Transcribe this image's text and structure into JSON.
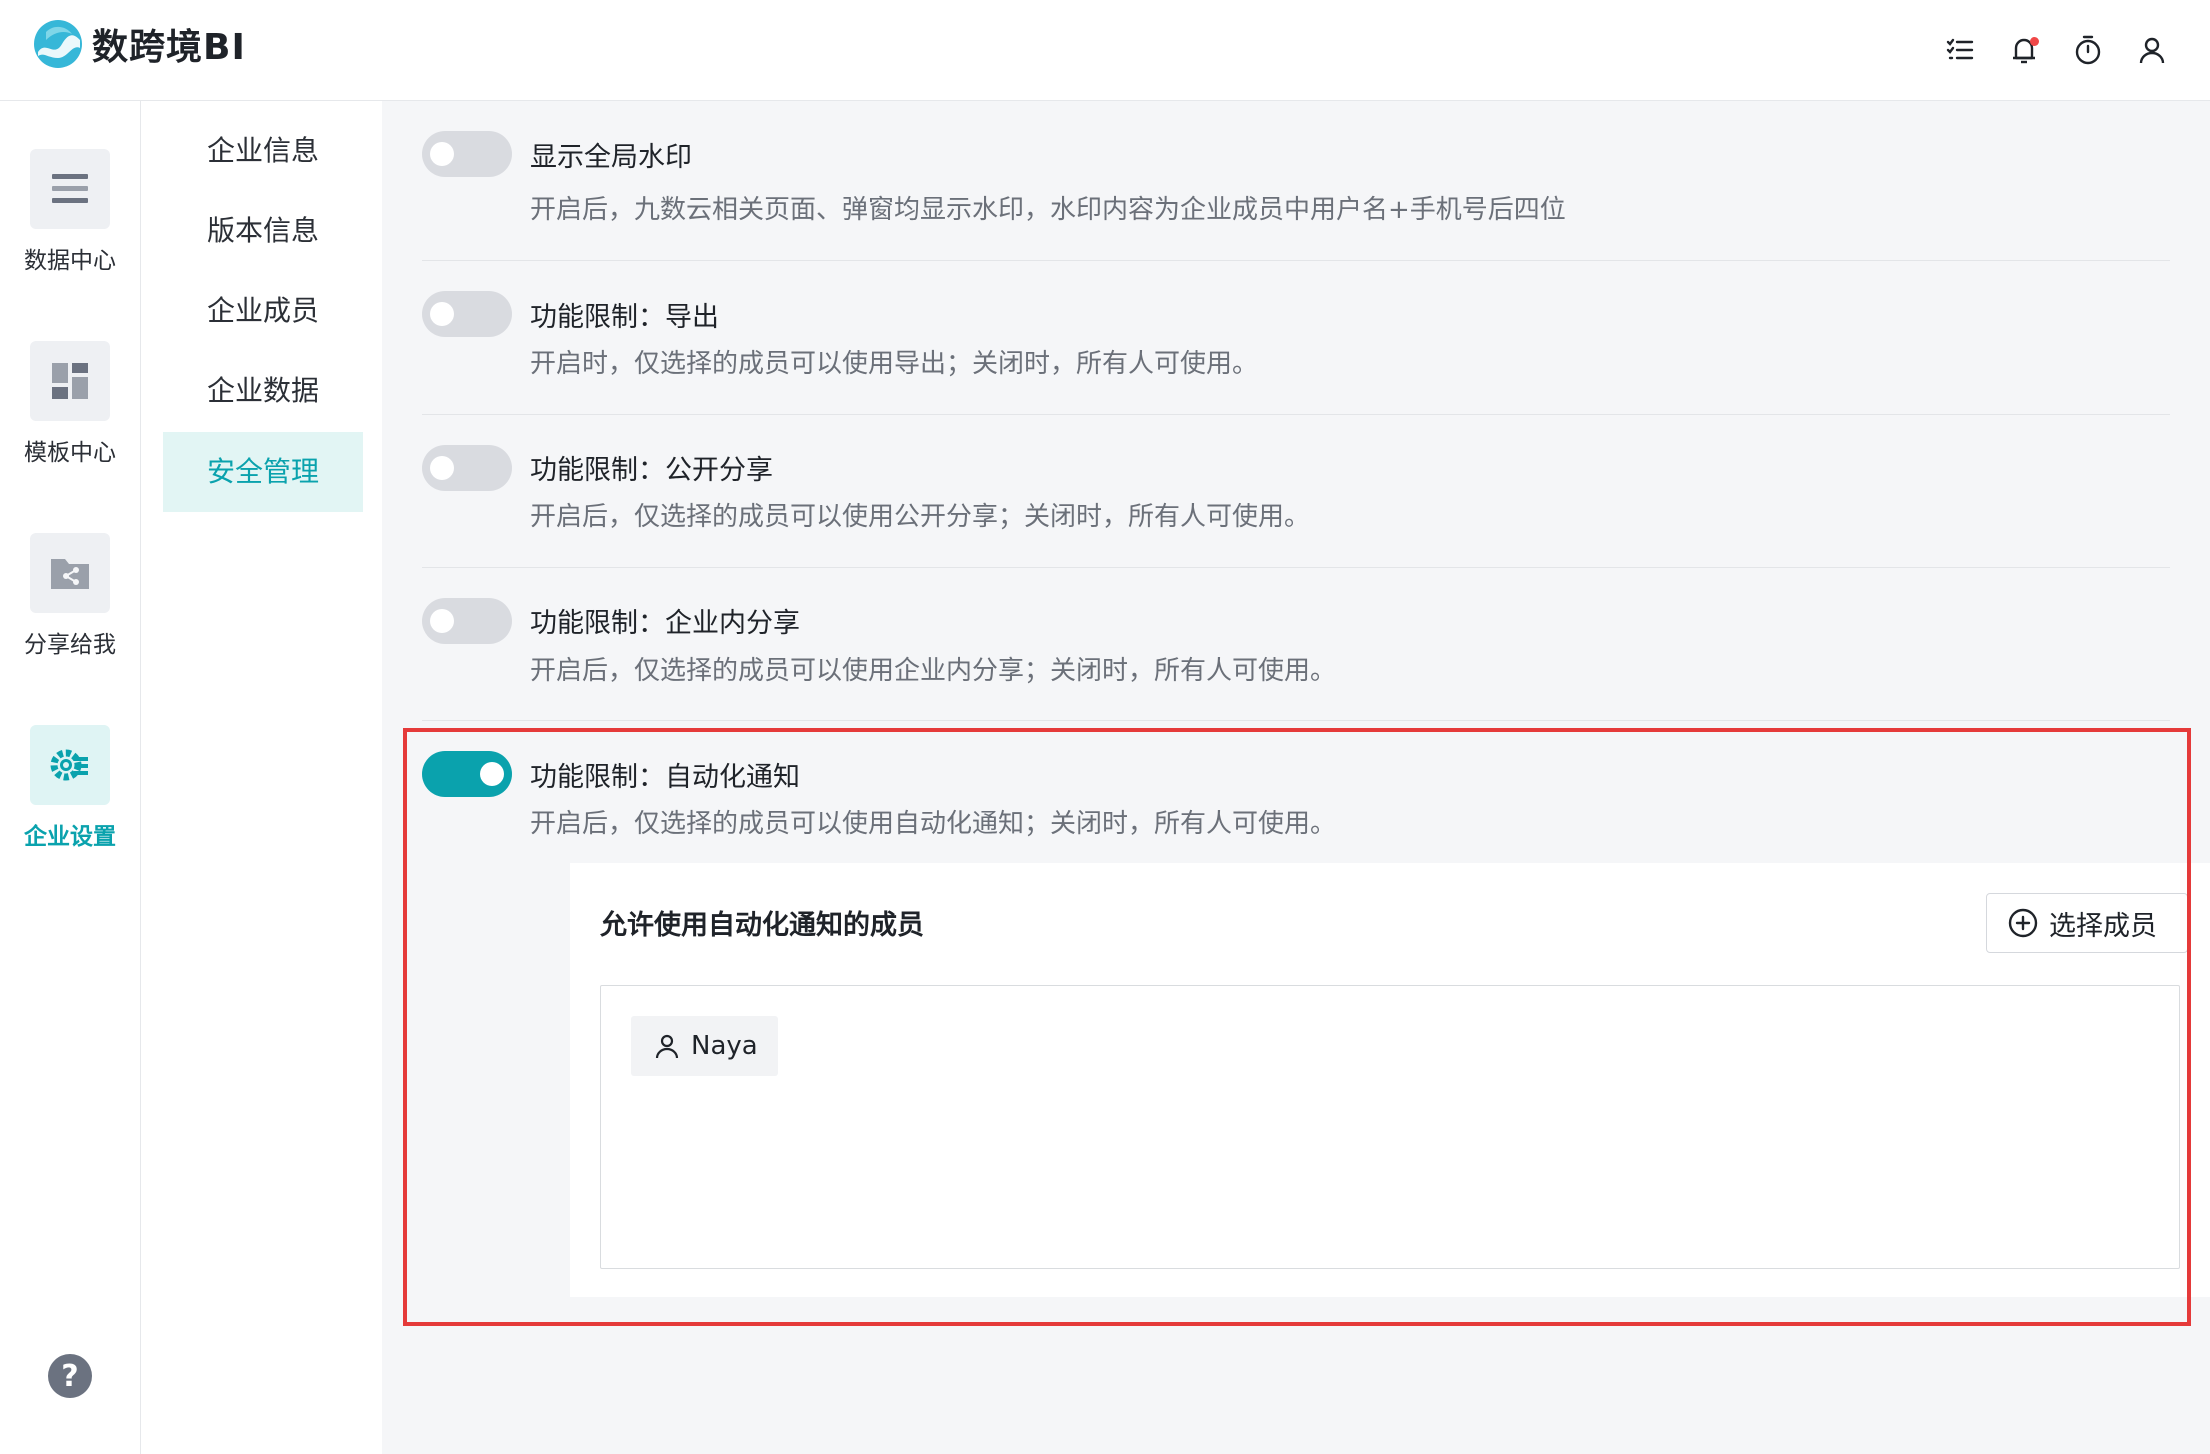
{
  "app": {
    "name": "数跨境BI"
  },
  "header_icons": [
    "task-list-icon",
    "bell-icon",
    "timer-icon",
    "user-icon"
  ],
  "rail": [
    {
      "label": "数据中心",
      "icon": "data-center-icon",
      "active": false
    },
    {
      "label": "模板中心",
      "icon": "template-center-icon",
      "active": false
    },
    {
      "label": "分享给我",
      "icon": "shared-folder-icon",
      "active": false
    },
    {
      "label": "企业设置",
      "icon": "gear-list-icon",
      "active": true
    }
  ],
  "help_label": "?",
  "subnav": [
    {
      "label": "企业信息",
      "active": false
    },
    {
      "label": "版本信息",
      "active": false
    },
    {
      "label": "企业成员",
      "active": false
    },
    {
      "label": "企业数据",
      "active": false
    },
    {
      "label": "安全管理",
      "active": true
    }
  ],
  "settings": [
    {
      "title": "显示全局水印",
      "desc": "开启后，九数云相关页面、弹窗均显示水印，水印内容为企业成员中用户名+手机号后四位",
      "enabled": false
    },
    {
      "title": "功能限制：导出",
      "desc": "开启时，仅选择的成员可以使用导出；关闭时，所有人可使用。",
      "enabled": false
    },
    {
      "title": "功能限制：公开分享",
      "desc": "开启后，仅选择的成员可以使用公开分享；关闭时，所有人可使用。",
      "enabled": false
    },
    {
      "title": "功能限制：企业内分享",
      "desc": "开启后，仅选择的成员可以使用企业内分享；关闭时，所有人可使用。",
      "enabled": false
    },
    {
      "title": "功能限制：自动化通知",
      "desc": "开启后，仅选择的成员可以使用自动化通知；关闭时，所有人可使用。",
      "enabled": true
    }
  ],
  "member_panel": {
    "title": "允许使用自动化通知的成员",
    "select_button": "选择成员",
    "members": [
      {
        "name": "Naya"
      }
    ]
  },
  "colors": {
    "accent": "#0aa2ad",
    "highlight": "#e53a3a",
    "toggle_off": "#d9dbe0"
  }
}
